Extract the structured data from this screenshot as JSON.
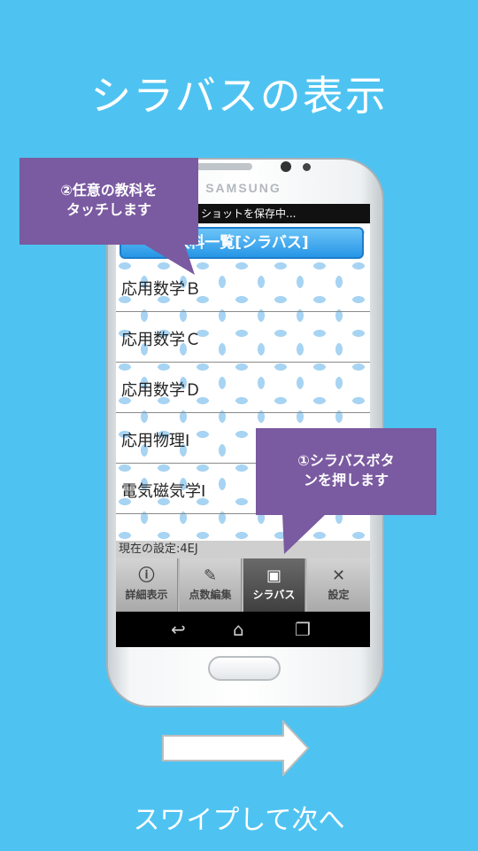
{
  "page": {
    "title": "シラバスの表示",
    "footer": "スワイプして次へ"
  },
  "phone": {
    "brand": "SAMSUNG",
    "status_text": "ショットを保存中...",
    "header": "教科一覧[シラバス]",
    "list_items": [
      "応用数学Ｂ",
      "応用数学Ｃ",
      "応用数学Ｄ",
      "応用物理Ⅰ",
      "電気磁気学Ⅰ"
    ],
    "current_setting": "現在の設定:4EJ",
    "tabs": [
      {
        "label": "詳細表示",
        "icon": "info-icon",
        "active": false
      },
      {
        "label": "点数編集",
        "icon": "pencil-icon",
        "active": false
      },
      {
        "label": "シラバス",
        "icon": "image-icon",
        "active": true
      },
      {
        "label": "設定",
        "icon": "tools-icon",
        "active": false
      }
    ]
  },
  "callouts": {
    "top": "②任意の教科を\nタッチします",
    "bottom": "①シラバスボタ\nンを押します"
  },
  "colors": {
    "background": "#4ec3f1",
    "callout": "#7a5aa0",
    "header_blue": "#2796e6"
  }
}
